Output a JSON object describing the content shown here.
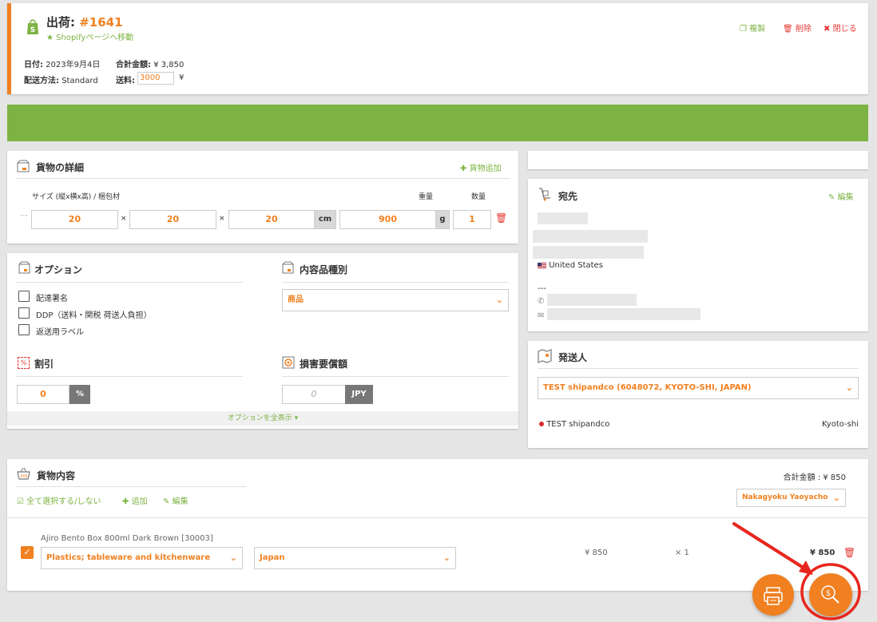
{
  "header": {
    "shipment_label": "出荷:",
    "shipment_number": "#1641",
    "shopify_link": "★ Shopifyページへ移動",
    "actions": {
      "duplicate": "複製",
      "delete": "削除",
      "close": "閉じる"
    },
    "date_label": "日付:",
    "date_value": "2023年9月4日",
    "total_label": "合計金額:",
    "total_value": "¥ 3,850",
    "shipping_method_label": "配送方法:",
    "shipping_method_value": "Standard",
    "shipping_fee_label": "送料:",
    "shipping_fee_value": "3000",
    "shipping_fee_unit": "¥"
  },
  "package": {
    "title": "貨物の詳細",
    "add_label": "貨物追加",
    "size_header": "サイズ (縦x横x高) / 梱包材",
    "weight_header": "重量",
    "qty_header": "数量",
    "length": "20",
    "width": "20",
    "height": "20",
    "times": "×",
    "dim_unit": "cm",
    "weight": "900",
    "weight_unit": "g",
    "quantity": "1",
    "drag": "⋯"
  },
  "options": {
    "title": "オプション",
    "items": [
      "配達署名",
      "DDP（送料・関税 荷送人負担）",
      "返送用ラベル"
    ],
    "content_type_title": "内容品種別",
    "content_type_value": "商品",
    "discount_title": "割引",
    "discount_value": "0",
    "discount_unit": "%",
    "insurance_title": "損害要償額",
    "insurance_placeholder": "0",
    "insurance_unit": "JPY",
    "show_all": "オプションを全表示 ▾"
  },
  "recipient": {
    "title": "宛先",
    "edit_label": "編集",
    "country": "United States",
    "separator": "---"
  },
  "sender": {
    "title": "発送人",
    "select_value": "TEST shipandco (6048072, KYOTO-SHI, JAPAN)",
    "name": "TEST shipandco",
    "city": "Kyoto-shi"
  },
  "contents": {
    "title": "貨物内容",
    "total_label": "合計金額 : ¥ 850",
    "select_all": "全て選択する/しない",
    "add_label": "追加",
    "edit_label": "編集",
    "origin_select": "Nakagyoku Yaoyacho '",
    "items": [
      {
        "name": "Ajiro Bento Box 800ml Dark Brown [30003]",
        "category": "Plastics; tableware and kitchenware",
        "country": "Japan",
        "unit_price": "¥ 850",
        "qty": "× 1",
        "total": "¥ 850"
      }
    ]
  },
  "colors": {
    "accent": "#f08020",
    "green": "#7cb342",
    "red": "#e53935",
    "annotation": "#e8261e"
  },
  "icons": [
    "shopify-icon",
    "duplicate-icon",
    "trash-icon",
    "close-icon",
    "box-icon",
    "plus-icon",
    "pencil-icon",
    "dolly-icon",
    "map-icon",
    "percent-icon",
    "shield-icon",
    "basket-icon",
    "checkbox-icon",
    "printer-icon",
    "money-search-icon"
  ]
}
